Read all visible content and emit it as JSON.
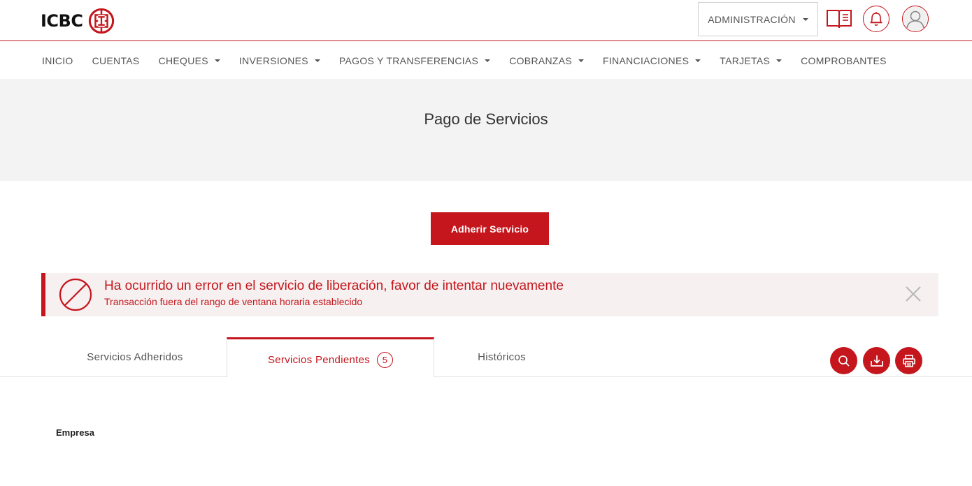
{
  "brand": {
    "name": "ICBC",
    "color": "#c4161c"
  },
  "header": {
    "admin_label": "ADMINISTRACIÓN",
    "icons": [
      "book-icon",
      "bell-icon",
      "user-avatar-icon"
    ]
  },
  "nav": {
    "items": [
      {
        "label": "INICIO",
        "dropdown": false
      },
      {
        "label": "CUENTAS",
        "dropdown": false
      },
      {
        "label": "CHEQUES",
        "dropdown": true
      },
      {
        "label": "INVERSIONES",
        "dropdown": true
      },
      {
        "label": "PAGOS Y TRANSFERENCIAS",
        "dropdown": true
      },
      {
        "label": "COBRANZAS",
        "dropdown": true
      },
      {
        "label": "FINANCIACIONES",
        "dropdown": true
      },
      {
        "label": "TARJETAS",
        "dropdown": true
      },
      {
        "label": "COMPROBANTES",
        "dropdown": false
      }
    ]
  },
  "page": {
    "title": "Pago de Servicios",
    "primary_action": "Adherir Servicio"
  },
  "alert": {
    "type": "error",
    "title": "Ha ocurrido un error en el servicio de liberación, favor de intentar nuevamente",
    "message": "Transacción fuera del rango de ventana horaria establecido"
  },
  "tabs": [
    {
      "label": "Servicios Adheridos",
      "active": false
    },
    {
      "label": "Servicios Pendientes",
      "active": true,
      "count": "5"
    },
    {
      "label": "Históricos",
      "active": false
    }
  ],
  "toolbar": {
    "icons": [
      "search-icon",
      "download-icon",
      "print-icon"
    ]
  },
  "table": {
    "columns": [
      "Empresa"
    ]
  }
}
